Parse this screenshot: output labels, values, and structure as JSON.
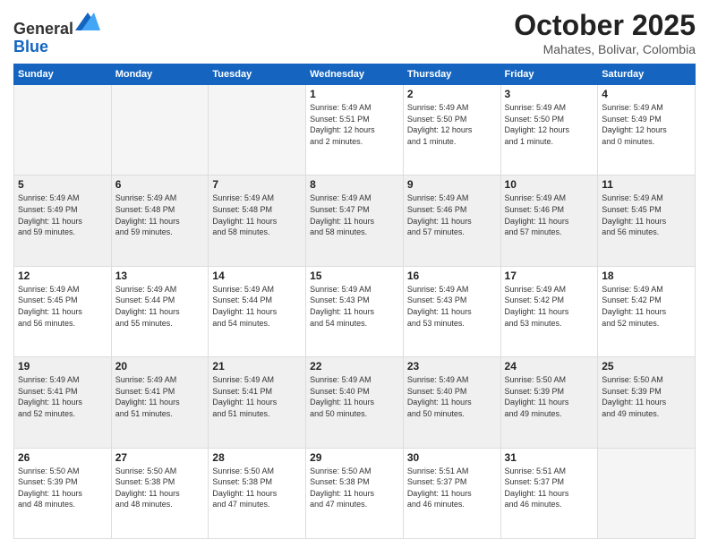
{
  "header": {
    "logo": {
      "general": "General",
      "blue": "Blue"
    },
    "title": "October 2025",
    "subtitle": "Mahates, Bolivar, Colombia"
  },
  "calendar": {
    "days_of_week": [
      "Sunday",
      "Monday",
      "Tuesday",
      "Wednesday",
      "Thursday",
      "Friday",
      "Saturday"
    ],
    "weeks": [
      [
        {
          "day": "",
          "info": ""
        },
        {
          "day": "",
          "info": ""
        },
        {
          "day": "",
          "info": ""
        },
        {
          "day": "1",
          "info": "Sunrise: 5:49 AM\nSunset: 5:51 PM\nDaylight: 12 hours\nand 2 minutes."
        },
        {
          "day": "2",
          "info": "Sunrise: 5:49 AM\nSunset: 5:50 PM\nDaylight: 12 hours\nand 1 minute."
        },
        {
          "day": "3",
          "info": "Sunrise: 5:49 AM\nSunset: 5:50 PM\nDaylight: 12 hours\nand 1 minute."
        },
        {
          "day": "4",
          "info": "Sunrise: 5:49 AM\nSunset: 5:49 PM\nDaylight: 12 hours\nand 0 minutes."
        }
      ],
      [
        {
          "day": "5",
          "info": "Sunrise: 5:49 AM\nSunset: 5:49 PM\nDaylight: 11 hours\nand 59 minutes."
        },
        {
          "day": "6",
          "info": "Sunrise: 5:49 AM\nSunset: 5:48 PM\nDaylight: 11 hours\nand 59 minutes."
        },
        {
          "day": "7",
          "info": "Sunrise: 5:49 AM\nSunset: 5:48 PM\nDaylight: 11 hours\nand 58 minutes."
        },
        {
          "day": "8",
          "info": "Sunrise: 5:49 AM\nSunset: 5:47 PM\nDaylight: 11 hours\nand 58 minutes."
        },
        {
          "day": "9",
          "info": "Sunrise: 5:49 AM\nSunset: 5:46 PM\nDaylight: 11 hours\nand 57 minutes."
        },
        {
          "day": "10",
          "info": "Sunrise: 5:49 AM\nSunset: 5:46 PM\nDaylight: 11 hours\nand 57 minutes."
        },
        {
          "day": "11",
          "info": "Sunrise: 5:49 AM\nSunset: 5:45 PM\nDaylight: 11 hours\nand 56 minutes."
        }
      ],
      [
        {
          "day": "12",
          "info": "Sunrise: 5:49 AM\nSunset: 5:45 PM\nDaylight: 11 hours\nand 56 minutes."
        },
        {
          "day": "13",
          "info": "Sunrise: 5:49 AM\nSunset: 5:44 PM\nDaylight: 11 hours\nand 55 minutes."
        },
        {
          "day": "14",
          "info": "Sunrise: 5:49 AM\nSunset: 5:44 PM\nDaylight: 11 hours\nand 54 minutes."
        },
        {
          "day": "15",
          "info": "Sunrise: 5:49 AM\nSunset: 5:43 PM\nDaylight: 11 hours\nand 54 minutes."
        },
        {
          "day": "16",
          "info": "Sunrise: 5:49 AM\nSunset: 5:43 PM\nDaylight: 11 hours\nand 53 minutes."
        },
        {
          "day": "17",
          "info": "Sunrise: 5:49 AM\nSunset: 5:42 PM\nDaylight: 11 hours\nand 53 minutes."
        },
        {
          "day": "18",
          "info": "Sunrise: 5:49 AM\nSunset: 5:42 PM\nDaylight: 11 hours\nand 52 minutes."
        }
      ],
      [
        {
          "day": "19",
          "info": "Sunrise: 5:49 AM\nSunset: 5:41 PM\nDaylight: 11 hours\nand 52 minutes."
        },
        {
          "day": "20",
          "info": "Sunrise: 5:49 AM\nSunset: 5:41 PM\nDaylight: 11 hours\nand 51 minutes."
        },
        {
          "day": "21",
          "info": "Sunrise: 5:49 AM\nSunset: 5:41 PM\nDaylight: 11 hours\nand 51 minutes."
        },
        {
          "day": "22",
          "info": "Sunrise: 5:49 AM\nSunset: 5:40 PM\nDaylight: 11 hours\nand 50 minutes."
        },
        {
          "day": "23",
          "info": "Sunrise: 5:49 AM\nSunset: 5:40 PM\nDaylight: 11 hours\nand 50 minutes."
        },
        {
          "day": "24",
          "info": "Sunrise: 5:50 AM\nSunset: 5:39 PM\nDaylight: 11 hours\nand 49 minutes."
        },
        {
          "day": "25",
          "info": "Sunrise: 5:50 AM\nSunset: 5:39 PM\nDaylight: 11 hours\nand 49 minutes."
        }
      ],
      [
        {
          "day": "26",
          "info": "Sunrise: 5:50 AM\nSunset: 5:39 PM\nDaylight: 11 hours\nand 48 minutes."
        },
        {
          "day": "27",
          "info": "Sunrise: 5:50 AM\nSunset: 5:38 PM\nDaylight: 11 hours\nand 48 minutes."
        },
        {
          "day": "28",
          "info": "Sunrise: 5:50 AM\nSunset: 5:38 PM\nDaylight: 11 hours\nand 47 minutes."
        },
        {
          "day": "29",
          "info": "Sunrise: 5:50 AM\nSunset: 5:38 PM\nDaylight: 11 hours\nand 47 minutes."
        },
        {
          "day": "30",
          "info": "Sunrise: 5:51 AM\nSunset: 5:37 PM\nDaylight: 11 hours\nand 46 minutes."
        },
        {
          "day": "31",
          "info": "Sunrise: 5:51 AM\nSunset: 5:37 PM\nDaylight: 11 hours\nand 46 minutes."
        },
        {
          "day": "",
          "info": ""
        }
      ]
    ]
  }
}
